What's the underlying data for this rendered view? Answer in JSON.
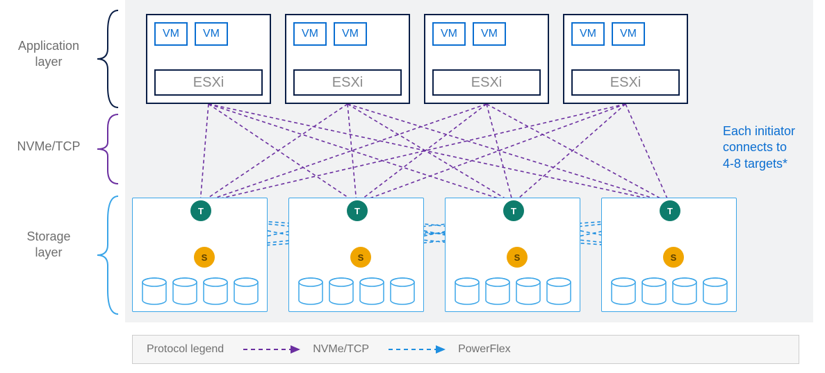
{
  "layers": {
    "application": {
      "label_line1": "Application",
      "label_line2": "layer"
    },
    "nvme": {
      "label": "NVMe/TCP"
    },
    "storage": {
      "label_line1": "Storage",
      "label_line2": "layer"
    }
  },
  "esxi_hosts": [
    {
      "vm1": "VM",
      "vm2": "VM",
      "label": "ESXi"
    },
    {
      "vm1": "VM",
      "vm2": "VM",
      "label": "ESXi"
    },
    {
      "vm1": "VM",
      "vm2": "VM",
      "label": "ESXi"
    },
    {
      "vm1": "VM",
      "vm2": "VM",
      "label": "ESXi"
    }
  ],
  "storage_nodes": [
    {
      "t": "T",
      "s": "S"
    },
    {
      "t": "T",
      "s": "S"
    },
    {
      "t": "T",
      "s": "S"
    },
    {
      "t": "T",
      "s": "S"
    }
  ],
  "callout": {
    "line1": "Each initiator",
    "line2": "connects to",
    "line3": "4-8 targets*"
  },
  "legend": {
    "title": "Protocol legend",
    "nvme_label": "NVMe/TCP",
    "powerflex_label": "PowerFlex"
  },
  "chart_data": {
    "type": "network-diagram",
    "description": "Two-tier architecture showing ESXi hosts (initiators) connecting to storage targets over NVMe/TCP, and storage targets (T) meshed to storage servers (S) over PowerFlex protocol.",
    "layers": [
      "Application layer",
      "NVMe/TCP",
      "Storage layer"
    ],
    "application_layer": {
      "host_count": 4,
      "host_type": "ESXi",
      "vms_per_host": 2
    },
    "storage_layer": {
      "node_count": 4,
      "components_per_node": {
        "T_target": 1,
        "S_server": 1,
        "disks": 4
      }
    },
    "connectivity": {
      "esxi_to_T": {
        "protocol": "NVMe/TCP",
        "topology": "full-mesh",
        "note": "Each initiator connects to 4-8 targets*"
      },
      "T_to_S": {
        "protocol": "PowerFlex",
        "topology": "full-mesh"
      }
    },
    "protocol_colors": {
      "NVMe/TCP": "#6b2fa0",
      "PowerFlex": "#1f8fe0"
    }
  }
}
